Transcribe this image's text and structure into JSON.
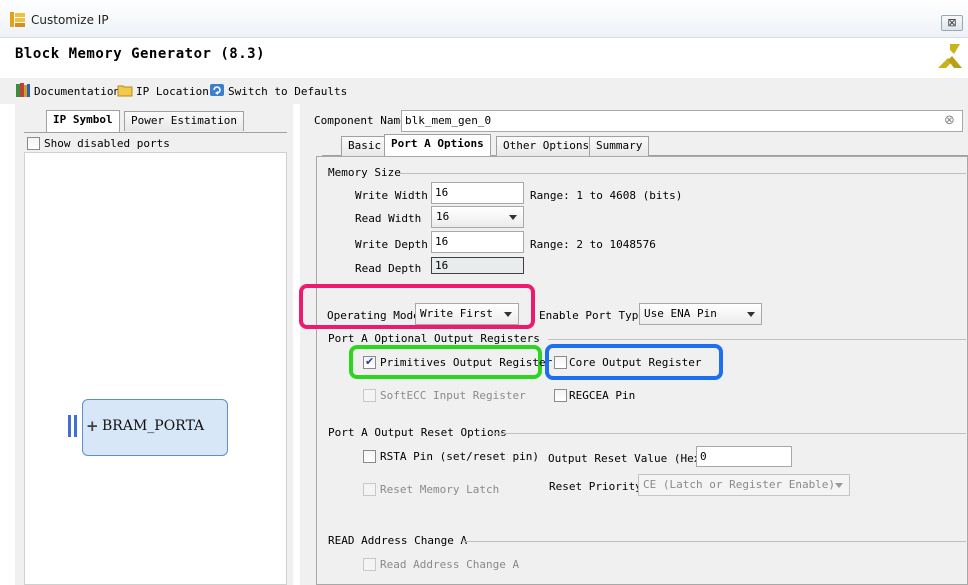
{
  "window": {
    "title": "Customize IP",
    "close_glyph": "⊠"
  },
  "header": {
    "ip_title": "Block Memory Generator (8.3)"
  },
  "toolbar": {
    "documentation": "Documentation",
    "ip_location": "IP Location",
    "switch_defaults": "Switch to Defaults"
  },
  "left_tabs": {
    "ip_symbol": "IP Symbol",
    "power_estimation": "Power Estimation"
  },
  "symbol": {
    "show_disabled_ports": "Show disabled ports",
    "port_name": "BRAM_PORTA",
    "port_glyph": "+"
  },
  "component": {
    "label": "Component Name",
    "value": "blk_mem_gen_0",
    "clear_glyph": "⊗"
  },
  "right_tabs": {
    "basic": "Basic",
    "port_a": "Port A Options",
    "other": "Other Options",
    "summary": "Summary"
  },
  "memory_size": {
    "heading": "Memory Size",
    "write_width_label": "Write Width",
    "write_width_value": "16",
    "write_width_range": "Range: 1 to 4608 (bits)",
    "read_width_label": "Read Width",
    "read_width_value": "16",
    "write_depth_label": "Write Depth",
    "write_depth_value": "16",
    "write_depth_range": "Range: 2 to 1048576",
    "read_depth_label": "Read Depth",
    "read_depth_value": "16"
  },
  "operating": {
    "mode_label": "Operating Mode",
    "mode_value": "Write First",
    "enable_label": "Enable Port Type",
    "enable_value": "Use ENA Pin"
  },
  "output_regs": {
    "heading": "Port A Optional Output Registers",
    "primitives": "Primitives Output Register",
    "primitives_checked": true,
    "core": "Core Output Register",
    "core_checked": false,
    "softecc": "SoftECC Input Register",
    "regcea": "REGCEA Pin"
  },
  "reset": {
    "heading": "Port A Output Reset Options",
    "rsta": "RSTA Pin (set/reset pin)",
    "output_reset_label": "Output Reset Value (Hex)",
    "output_reset_value": "0",
    "reset_memory_latch": "Reset Memory Latch",
    "priority_label": "Reset Priority",
    "priority_value": "CE (Latch or Register Enable)"
  },
  "read_address": {
    "heading": "READ Address Change A",
    "option": "Read Address Change A"
  },
  "colors": {
    "highlight_pink": "#ee1a6e",
    "highlight_green": "#2ed51e",
    "highlight_blue": "#1e6ff0",
    "logo_yellow": "#c9b21b"
  }
}
